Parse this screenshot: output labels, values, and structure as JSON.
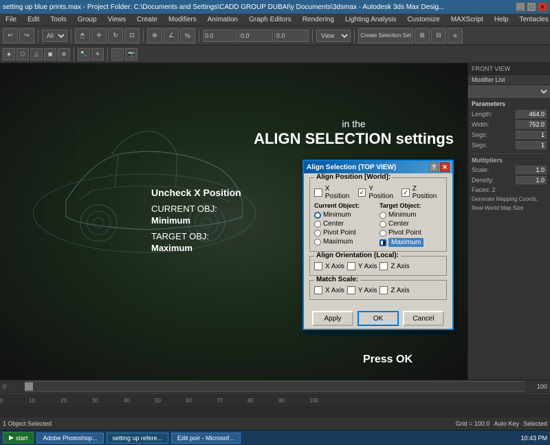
{
  "titlebar": {
    "text": "setting up blue prints.max - Project Folder: C:\\Documents and Settings\\CADD GROUP DUBAI\\y Documents\\3dsmax - Autodesk 3ds Max Desig...",
    "controls": [
      "minimize",
      "maximize",
      "close"
    ]
  },
  "menubar": {
    "items": [
      "File",
      "Edit",
      "Tools",
      "Group",
      "Views",
      "Create",
      "Modifiers",
      "Animation",
      "Graph Editors",
      "Rendering",
      "Lighting Analysis",
      "Customize",
      "MAXScript",
      "Help",
      "Tentacles"
    ]
  },
  "toolbar": {
    "select_label": "All",
    "view_label": "View"
  },
  "overlay": {
    "line1": "in the",
    "line2": "ALIGN SELECTION settings",
    "instruction1": "Uncheck X Position",
    "instruction2": "CURRENT OBJ:",
    "instruction3": "Minimum",
    "instruction4": "TARGET OBJ:",
    "instruction5": "Maximum",
    "press_ok": "Press OK"
  },
  "dialog": {
    "title": "Align Selection (TOP VIEW)",
    "help_btn": "?",
    "close_btn": "✕",
    "align_position_group": "Align Position [World]:",
    "x_position_label": "X Position",
    "y_position_label": "Y Position",
    "z_position_label": "Z Position",
    "x_checked": false,
    "y_checked": true,
    "z_checked": true,
    "current_object_label": "Current Object:",
    "target_object_label": "Target Object:",
    "current_options": [
      "Minimum",
      "Center",
      "Pivot Point",
      "Maximum"
    ],
    "current_selected": "Minimum",
    "target_options": [
      "Minimum",
      "Center",
      "Pivot Point",
      "Maximum"
    ],
    "target_selected": "Maximum",
    "align_orientation_group": "Align Orientation (Local):",
    "orient_x_label": "X Axis",
    "orient_y_label": "Y Axis",
    "orient_z_label": "Z Axis",
    "match_scale_group": "Match Scale:",
    "scale_x_label": "X Axis",
    "scale_y_label": "Y Axis",
    "scale_z_label": "Z Axis",
    "apply_label": "Apply",
    "ok_label": "OK",
    "cancel_label": "Cancel"
  },
  "right_panel": {
    "header": "FRONT VIEW",
    "modifier_list_label": "Modifier List",
    "params_label": "Parameters",
    "length_label": "Length:",
    "length_value": "464.0",
    "width_label": "Width:",
    "width_value": "752.0",
    "segs1_label": "Segs:",
    "segs1_value": "1",
    "segs2_label": "Segs:",
    "segs2_value": "1",
    "multipliers_label": "Multipliers",
    "scale_label": "Scale:",
    "scale_value": "1.0",
    "density_label": "Density:",
    "density_value": "1.0",
    "faces_label": "Faces: 2",
    "map_coords_label": "Generate Mapping Coords.",
    "world_map_label": "Real-World Map Size"
  },
  "bottom": {
    "frame_start": "0",
    "frame_end": "100",
    "ruler_ticks": [
      "0",
      "10",
      "20",
      "30",
      "40",
      "50",
      "60",
      "70",
      "80",
      "90",
      "100"
    ]
  },
  "statusbar": {
    "text": "1 Object Selected",
    "grid_label": "Grid = 100.0",
    "auto_key": "Auto Key",
    "selected_label": "Selected"
  },
  "taskbar": {
    "start_label": "start",
    "items": [
      "Adobe Photoshop...",
      "setting up refere...",
      "Edit poir - Microsof..."
    ],
    "time": "10:43 PM"
  }
}
